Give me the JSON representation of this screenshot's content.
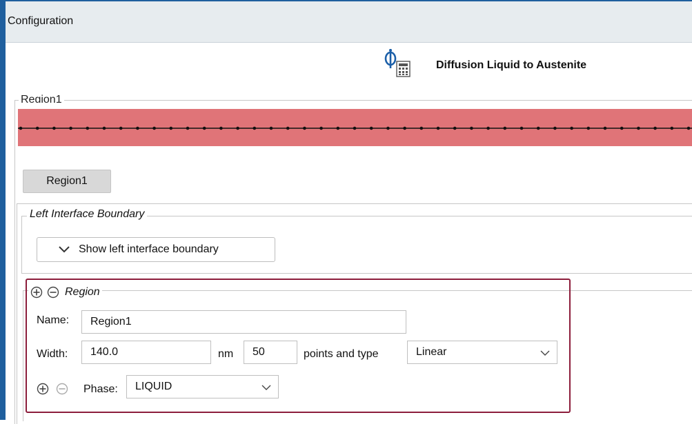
{
  "window": {
    "title": "Configuration"
  },
  "module": {
    "title": "Diffusion Liquid to Austenite",
    "icon": "diffusion-calculator-icon"
  },
  "geometry": {
    "group_label": "Region1",
    "bar_color": "#e07478"
  },
  "region_tab": {
    "label": "Region1"
  },
  "left_interface": {
    "legend": "Left Interface Boundary",
    "toggle_label": "Show left interface boundary"
  },
  "region": {
    "legend": "Region",
    "name_label": "Name:",
    "name_value": "Region1",
    "width_label": "Width:",
    "width_value": "140.0",
    "width_unit": "nm",
    "points_value": "50",
    "points_label": "points and type",
    "grid_type": "Linear",
    "phase_label": "Phase:",
    "phase_value": "LIQUID",
    "highlight_color": "#8c1c3a"
  }
}
